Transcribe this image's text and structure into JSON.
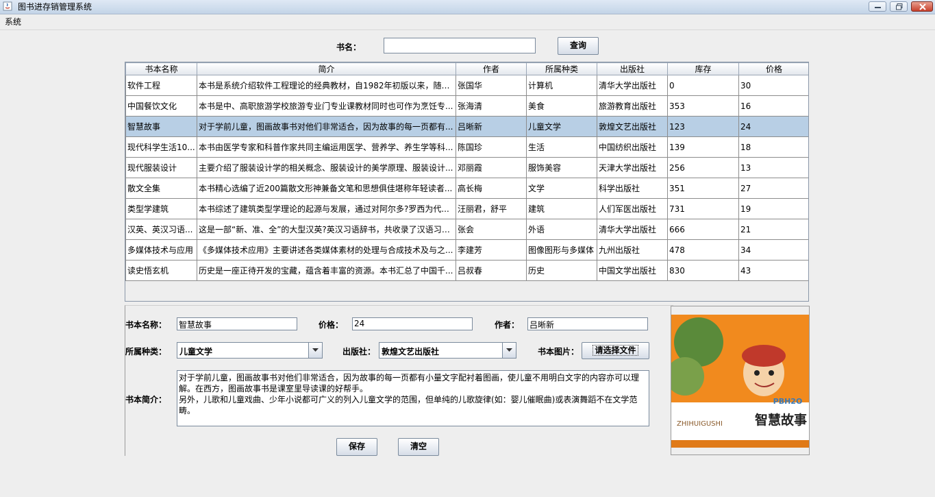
{
  "window": {
    "title": "图书进存销管理系统",
    "menu": [
      "系统"
    ]
  },
  "search": {
    "label": "书名：",
    "value": "",
    "button": "查询"
  },
  "table": {
    "columns": [
      "书本名称",
      "简介",
      "作者",
      "所属种类",
      "出版社",
      "库存",
      "价格"
    ],
    "rows": [
      [
        "软件工程",
        "本书是系统介绍软件工程理论的经典教材，自1982年初版以来，随着...",
        "张国华",
        "计算机",
        "清华大学出版社",
        "0",
        "30"
      ],
      [
        "中国餐饮文化",
        "本书是中、高职旅游学校旅游专业门专业课教材同时也可作为烹饪专...",
        "张海清",
        "美食",
        "旅游教育出版社",
        "353",
        "16"
      ],
      [
        "智慧故事",
        "对于学前儿童，图画故事书对他们非常适合，因为故事的每一页都有...",
        "吕晰新",
        "儿童文学",
        "敦煌文艺出版社",
        "123",
        "24"
      ],
      [
        "现代科学生活10...",
        "本书由医学专家和科普作家共同主编运用医学、营养学、养生学等科...",
        "陈国珍",
        "生活",
        "中国纺织出版社",
        "139",
        "18"
      ],
      [
        "现代服装设计",
        "主要介绍了服装设计学的相关概念、服装设计的美学原理、服装设计...",
        "邓丽霞",
        "服饰美容",
        "天津大学出版社",
        "256",
        "13"
      ],
      [
        "散文全集",
        "本书精心选编了近200篇散文形神兼备文笔和思想俱佳堪称年轻读者...",
        "高长梅",
        "文学",
        "科学出版社",
        "351",
        "27"
      ],
      [
        "类型学建筑",
        "本书综述了建筑类型学理论的起源与发展，通过对阿尔多?罗西为代...",
        "汪丽君，舒平",
        "建筑",
        "人们军医出版社",
        "731",
        "19"
      ],
      [
        "汉英、英汉习语...",
        "这是一部“新、准、全”的大型汉英?英汉习语辞书，共收录了汉语习语...",
        "张会",
        "外语",
        "清华大学出版社",
        "666",
        "21"
      ],
      [
        "多媒体技术与应用",
        "《多媒体技术应用》主要讲述各类媒体素材的处理与合成技术及与之...",
        "李建芳",
        "图像图形与多媒体",
        "九州出版社",
        "478",
        "34"
      ],
      [
        "读史悟玄机",
        "历史是一座正待开发的宝藏，蕴含着丰富的资源。本书汇总了中国千...",
        "吕叔春",
        "历史",
        "中国文学出版社",
        "830",
        "43"
      ]
    ],
    "selected_index": 2
  },
  "form": {
    "name_label": "书本名称：",
    "name_value": "智慧故事",
    "price_label": "价格：",
    "price_value": "24",
    "author_label": "作者：",
    "author_value": "吕晰新",
    "category_label": "所属种类：",
    "category_value": "儿童文学",
    "publisher_label": "出版社：",
    "publisher_value": "敦煌文艺出版社",
    "image_label": "书本图片：",
    "choose_file_button": "请选择文件",
    "summary_label": "书本简介：",
    "summary_value": "对于学前儿童，图画故事书对他们非常适合，因为故事的每一页都有小量文字配衬着图画，使儿童不用明白文字的内容亦可以理解。在西方，图画故事书是课室里导读课的好帮手。\n另外，儿歌和儿童戏曲、少年小说都可广义的列入儿童文学的范围，但单纯的儿歌旋律(如：婴儿催眠曲)或表演舞蹈不在文学范畴。",
    "save_button": "保存",
    "clear_button": "清空"
  },
  "cover": {
    "title_text": "智慧故事",
    "pinyin_text": "ZHIHUIGUSHI",
    "logo_text": "PBH2O",
    "colors": {
      "background": "#f18a1e",
      "band": "#ffffff",
      "accent": "#8a5a2a"
    }
  },
  "icons": [
    "java-app-icon",
    "minimize-icon",
    "maximize-icon",
    "close-icon",
    "chevron-down-icon"
  ]
}
